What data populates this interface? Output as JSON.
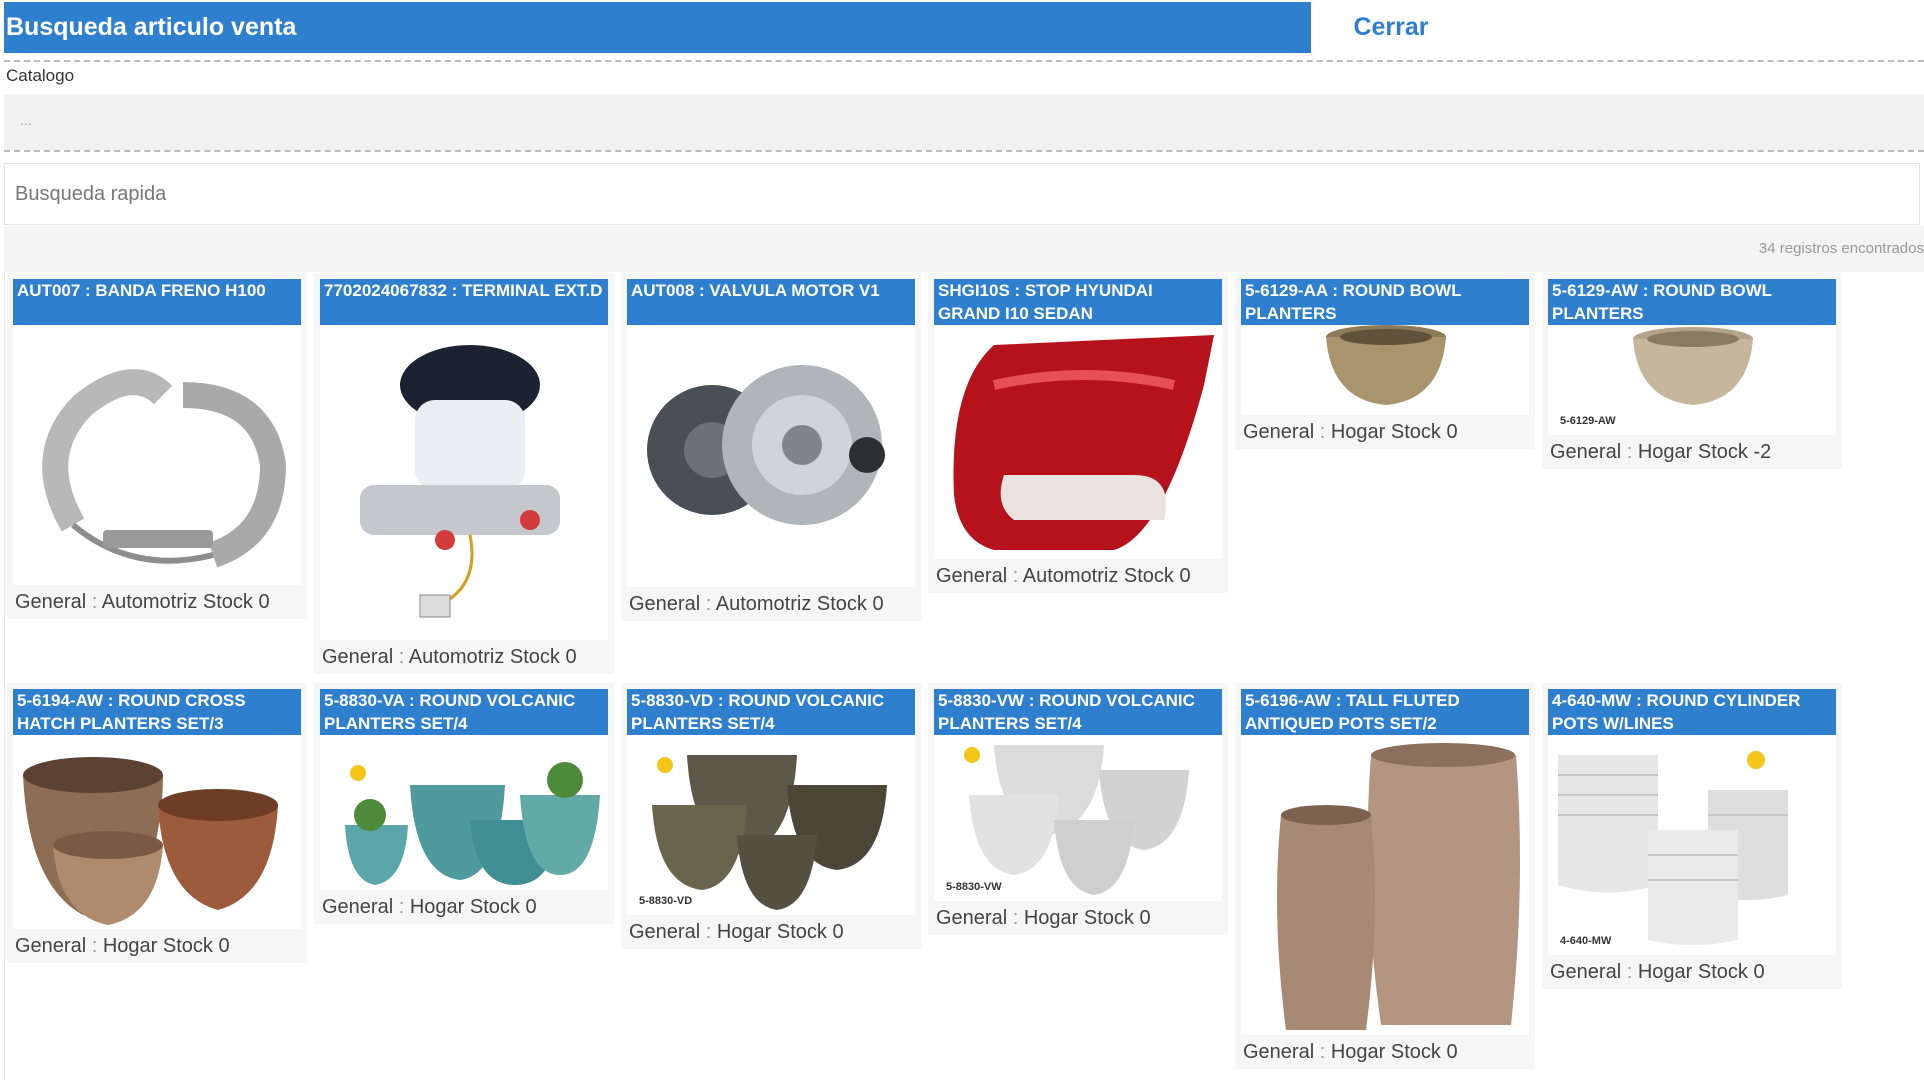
{
  "header": {
    "title": "Busqueda articulo venta",
    "close_label": "Cerrar"
  },
  "catalog": {
    "label": "Catalogo",
    "value": "..."
  },
  "search": {
    "placeholder": "Busqueda rapida"
  },
  "records": {
    "count_text": "34 registros encontrados"
  },
  "products": [
    {
      "title": "AUT007 : BANDA FRENO H100",
      "category": "General",
      "subcategory": "Automotriz",
      "stock": "Stock 0",
      "image": "brake-shoe-icon",
      "sku_label": ""
    },
    {
      "title": "7702024067832 : TERMINAL EXT.D",
      "category": "General",
      "subcategory": "Automotriz",
      "stock": "Stock 0",
      "image": "master-cylinder-icon",
      "sku_label": ""
    },
    {
      "title": "AUT008 : VALVULA MOTOR V1",
      "category": "General",
      "subcategory": "Automotriz",
      "stock": "Stock 0",
      "image": "clutch-kit-icon",
      "sku_label": ""
    },
    {
      "title": "SHGI10S : STOP HYUNDAI GRAND I10 SEDAN",
      "category": "General",
      "subcategory": "Automotriz",
      "stock": "Stock 0",
      "image": "tail-light-icon",
      "sku_label": ""
    },
    {
      "title": "5-6129-AA : ROUND BOWL PLANTERS",
      "category": "General",
      "subcategory": "Hogar",
      "stock": "Stock 0",
      "image": "bowl-planters-icon",
      "sku_label": ""
    },
    {
      "title": "5-6129-AW : ROUND BOWL PLANTERS",
      "category": "General",
      "subcategory": "Hogar",
      "stock": "Stock -2",
      "image": "bowl-planters-icon",
      "sku_label": "5-6129-AW"
    },
    {
      "title": "5-6194-AW : ROUND CROSS HATCH PLANTERS SET/3",
      "category": "General",
      "subcategory": "Hogar",
      "stock": "Stock 0",
      "image": "crosshatch-pots-icon",
      "sku_label": ""
    },
    {
      "title": "5-8830-VA : ROUND VOLCANIC PLANTERS SET/4",
      "category": "General",
      "subcategory": "Hogar",
      "stock": "Stock 0",
      "image": "volcanic-blue-pots-icon",
      "sku_label": ""
    },
    {
      "title": "5-8830-VD : ROUND VOLCANIC PLANTERS SET/4",
      "category": "General",
      "subcategory": "Hogar",
      "stock": "Stock 0",
      "image": "volcanic-dark-pots-icon",
      "sku_label": "5-8830-VD"
    },
    {
      "title": "5-8830-VW : ROUND VOLCANIC PLANTERS SET/4",
      "category": "General",
      "subcategory": "Hogar",
      "stock": "Stock 0",
      "image": "volcanic-white-pots-icon",
      "sku_label": "5-8830-VW"
    },
    {
      "title": "5-6196-AW : TALL FLUTED ANTIQUED POTS SET/2",
      "category": "General",
      "subcategory": "Hogar",
      "stock": "Stock 0",
      "image": "fluted-pots-icon",
      "sku_label": ""
    },
    {
      "title": "4-640-MW : ROUND CYLINDER POTS W/LINES",
      "category": "General",
      "subcategory": "Hogar",
      "stock": "Stock 0",
      "image": "cylinder-pots-icon",
      "sku_label": "4-640-MW"
    }
  ],
  "colors": {
    "accent": "#2f7fcf",
    "header_text": "#ffffff",
    "panel_bg": "#f6f6f6"
  }
}
